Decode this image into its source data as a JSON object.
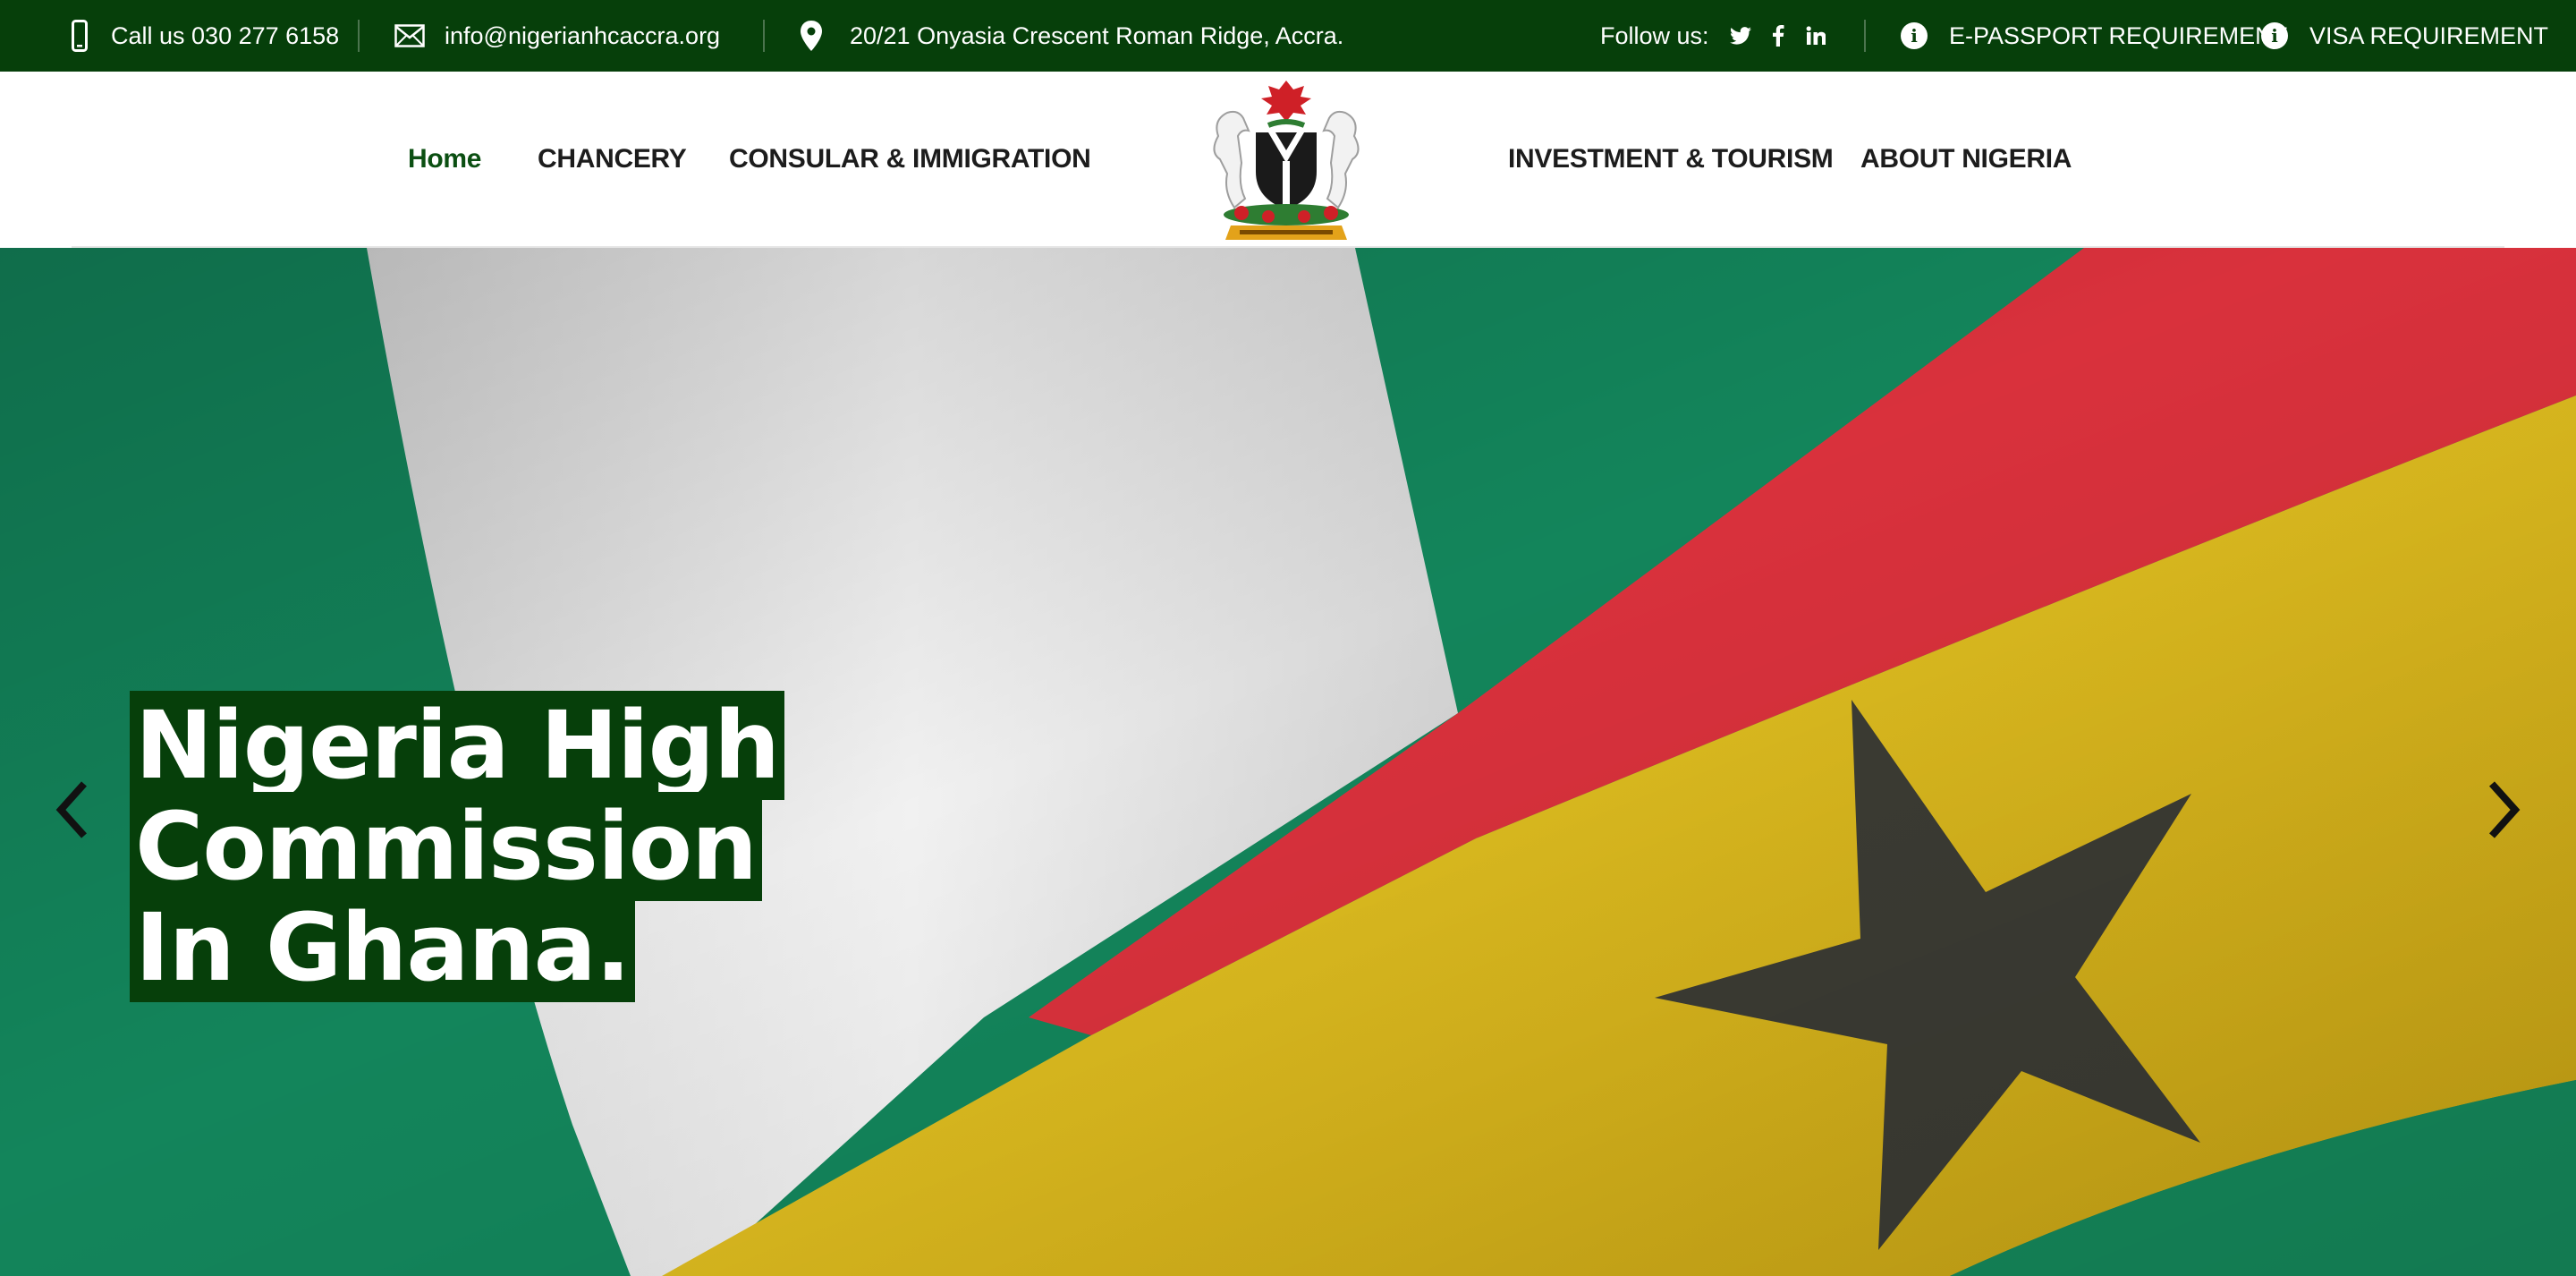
{
  "topbar": {
    "phone": "Call us 030 277 6158",
    "email": "info@nigerianhcaccra.org",
    "address": "20/21 Onyasia Crescent Roman Ridge, Accra.",
    "follow_label": "Follow us:",
    "socials": [
      "twitter-icon",
      "facebook-icon",
      "linkedin-icon"
    ],
    "epassport": "E-PASSPORT REQUIREMENT",
    "visa": "VISA REQUIREMENT",
    "background_color": "#063f0a"
  },
  "nav": {
    "home": "Home",
    "chancery": "CHANCERY",
    "consular": "CONSULAR & IMMIGRATION",
    "investment": "INVESTMENT & TOURISM",
    "about": "ABOUT NIGERIA",
    "active_color": "#0b4f12",
    "logo_icon": "nigeria-coat-of-arms-icon"
  },
  "hero": {
    "title_line1": "Nigeria High Commission",
    "title_line2": "In Ghana.",
    "highlight_color": "#063f0a",
    "prev_icon": "chevron-left-icon",
    "next_icon": "chevron-right-icon"
  }
}
